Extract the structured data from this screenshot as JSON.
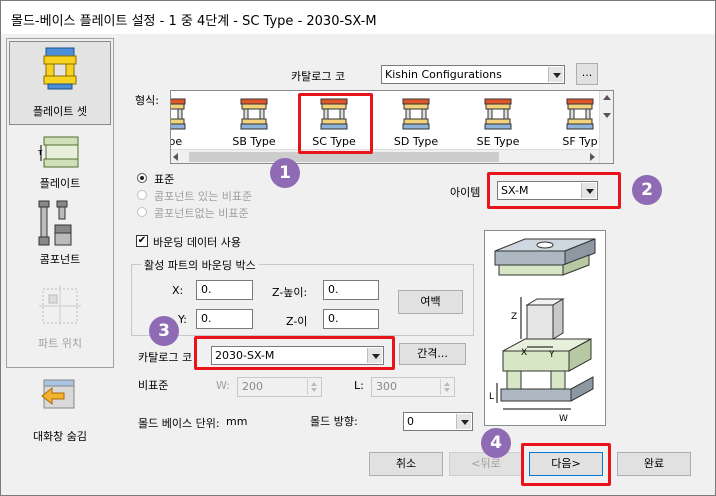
{
  "window": {
    "title": "몰드-베이스 플레이트 설정 - 1 중 4단계  - SC Type - 2030-SX-M"
  },
  "sidebar": {
    "items": [
      {
        "label": "플레이트 셋",
        "icon": "plate-set-icon",
        "active": true
      },
      {
        "label": "플레이트",
        "icon": "plate-icon",
        "active": false
      },
      {
        "label": "콤포넌트",
        "icon": "component-icon",
        "active": false
      },
      {
        "label": "파트 위치",
        "icon": "part-location-icon",
        "active": false,
        "disabled": true
      },
      {
        "label": "대화창 숨김",
        "icon": "hide-dialog-icon",
        "active": false
      }
    ]
  },
  "catalog": {
    "label": "카탈로그 코",
    "value": "Kishin Configurations",
    "browse_label": "..."
  },
  "type_section": {
    "label": "형식:",
    "types": [
      "ype",
      "SB Type",
      "SC Type",
      "SD Type",
      "SE Type",
      "SF Typ"
    ],
    "selected": "SC Type"
  },
  "radios": [
    {
      "label": "표준",
      "selected": true,
      "disabled": false
    },
    {
      "label": "콤포넌트 있는 비표준",
      "selected": false,
      "disabled": true
    },
    {
      "label": "콤포넌트없는 비표준",
      "selected": false,
      "disabled": true
    }
  ],
  "item": {
    "label": "아이템",
    "value": "SX-M"
  },
  "bounding": {
    "checkbox_label": "바운딩 데이터 사용",
    "checked": true,
    "group_title": "활성 파트의 바운딩 박스",
    "x_label": "X:",
    "x_value": "0.",
    "zh_label": "Z-높이:",
    "zh_value": "0.",
    "y_label": "Y:",
    "y_value": "0.",
    "z_label": "Z-이",
    "z_value": "0.",
    "margin_button": "여백"
  },
  "catalog_code": {
    "label": "카탈로그 코",
    "value": "2030-SX-M",
    "spacing_button": "간격..."
  },
  "nonstandard": {
    "label": "비표준",
    "w_label": "W:",
    "w_value": "200",
    "l_label": "L:",
    "l_value": "300"
  },
  "units": {
    "label": "몰드 베이스 단위:",
    "value": "mm"
  },
  "direction": {
    "label": "몰드 방향:",
    "value": "0"
  },
  "diagram": {
    "z_label": "Z",
    "x_label": "X",
    "y_label": "Y",
    "l_label": "L",
    "w_label": "W"
  },
  "buttons": {
    "cancel": "취소",
    "back": "<뒤로",
    "next": "다음>",
    "finish": "완료"
  },
  "badges": [
    "1",
    "2",
    "3",
    "4"
  ],
  "colors": {
    "highlight_red": "#e8131b",
    "badge_purple": "#8e6bb4",
    "plate_yellow": "#f7d21e",
    "plate_green": "#cfe0b8"
  }
}
